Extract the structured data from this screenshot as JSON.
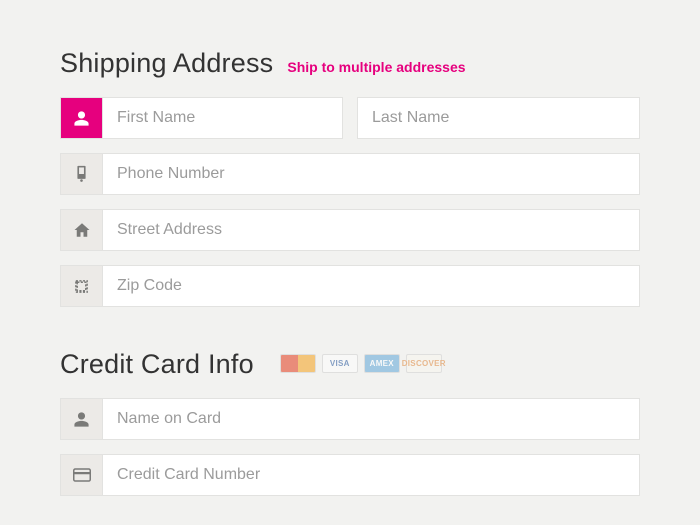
{
  "shipping": {
    "title": "Shipping Address",
    "multi_link": "Ship to multiple addresses",
    "first_name": {
      "placeholder": "First Name",
      "value": ""
    },
    "last_name": {
      "placeholder": "Last Name",
      "value": ""
    },
    "phone": {
      "placeholder": "Phone Number",
      "value": ""
    },
    "street": {
      "placeholder": "Street Address",
      "value": ""
    },
    "zip": {
      "placeholder": "Zip Code",
      "value": ""
    }
  },
  "credit": {
    "title": "Credit Card Info",
    "name": {
      "placeholder": "Name on Card",
      "value": ""
    },
    "number": {
      "placeholder": "Credit Card Number",
      "value": ""
    },
    "logos": [
      "MasterCard",
      "VISA",
      "AMEX",
      "DISCOVER"
    ]
  }
}
